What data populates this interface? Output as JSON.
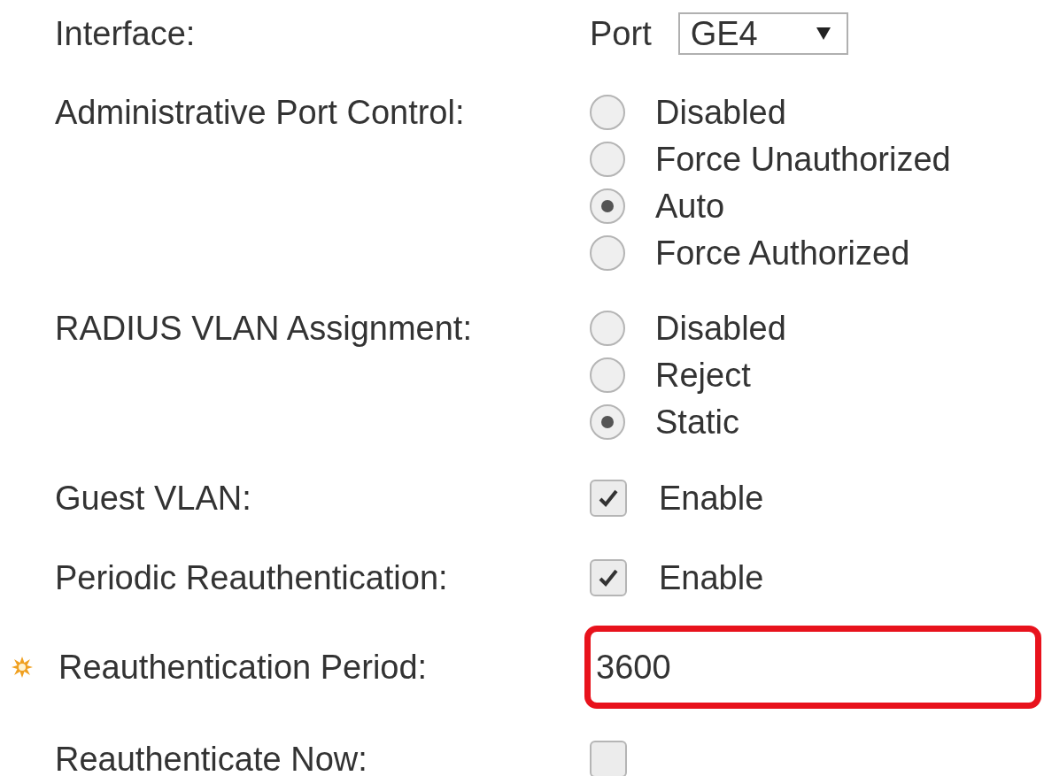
{
  "fields": [
    {
      "kind": "select",
      "label": "Interface:",
      "prefix": "Port",
      "value": "GE4"
    },
    {
      "kind": "radio",
      "label": "Administrative Port Control:",
      "options": [
        {
          "label": "Disabled",
          "selected": false
        },
        {
          "label": "Force Unauthorized",
          "selected": false
        },
        {
          "label": "Auto",
          "selected": true
        },
        {
          "label": "Force Authorized",
          "selected": false
        }
      ]
    },
    {
      "kind": "radio",
      "label": "RADIUS VLAN Assignment:",
      "options": [
        {
          "label": "Disabled",
          "selected": false
        },
        {
          "label": "Reject",
          "selected": false
        },
        {
          "label": "Static",
          "selected": true
        }
      ]
    },
    {
      "kind": "checkbox",
      "label": "Guest VLAN:",
      "checked": true,
      "option": "Enable"
    },
    {
      "kind": "checkbox",
      "label": "Periodic Reauthentication:",
      "checked": true,
      "option": "Enable"
    },
    {
      "kind": "text",
      "label": "Reauthentication Period:",
      "required": true,
      "value": "3600",
      "highlighted": true
    },
    {
      "kind": "checkbox",
      "label": "Reauthenticate Now:",
      "checked": false
    }
  ]
}
